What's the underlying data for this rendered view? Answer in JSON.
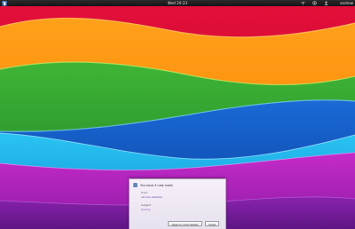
{
  "topbar": {
    "clock": "Wed 20:23",
    "user_name": "andrew"
  },
  "dialog": {
    "title": "You have 4 new mails",
    "from_label": "From",
    "from_value": "ubuntu-desktop",
    "subject_label": "Subject",
    "subject_value": "testing",
    "open_button": "Open in mail reader",
    "close_button": "Close"
  },
  "colors": {
    "topbar": "#1b1b1b",
    "accent_link": "#9a5ad6",
    "wallpaper_bands": [
      "#e0143c",
      "#ff8a00",
      "#27a233",
      "#0b5bc7",
      "#15a7e8",
      "#b01eb8",
      "#7d1fa0"
    ]
  },
  "icons": {
    "activities": "gnome-foot-icon",
    "tray": [
      "wifi-icon",
      "volume-icon",
      "user-status-icon"
    ],
    "dialog": "mail-icon"
  }
}
